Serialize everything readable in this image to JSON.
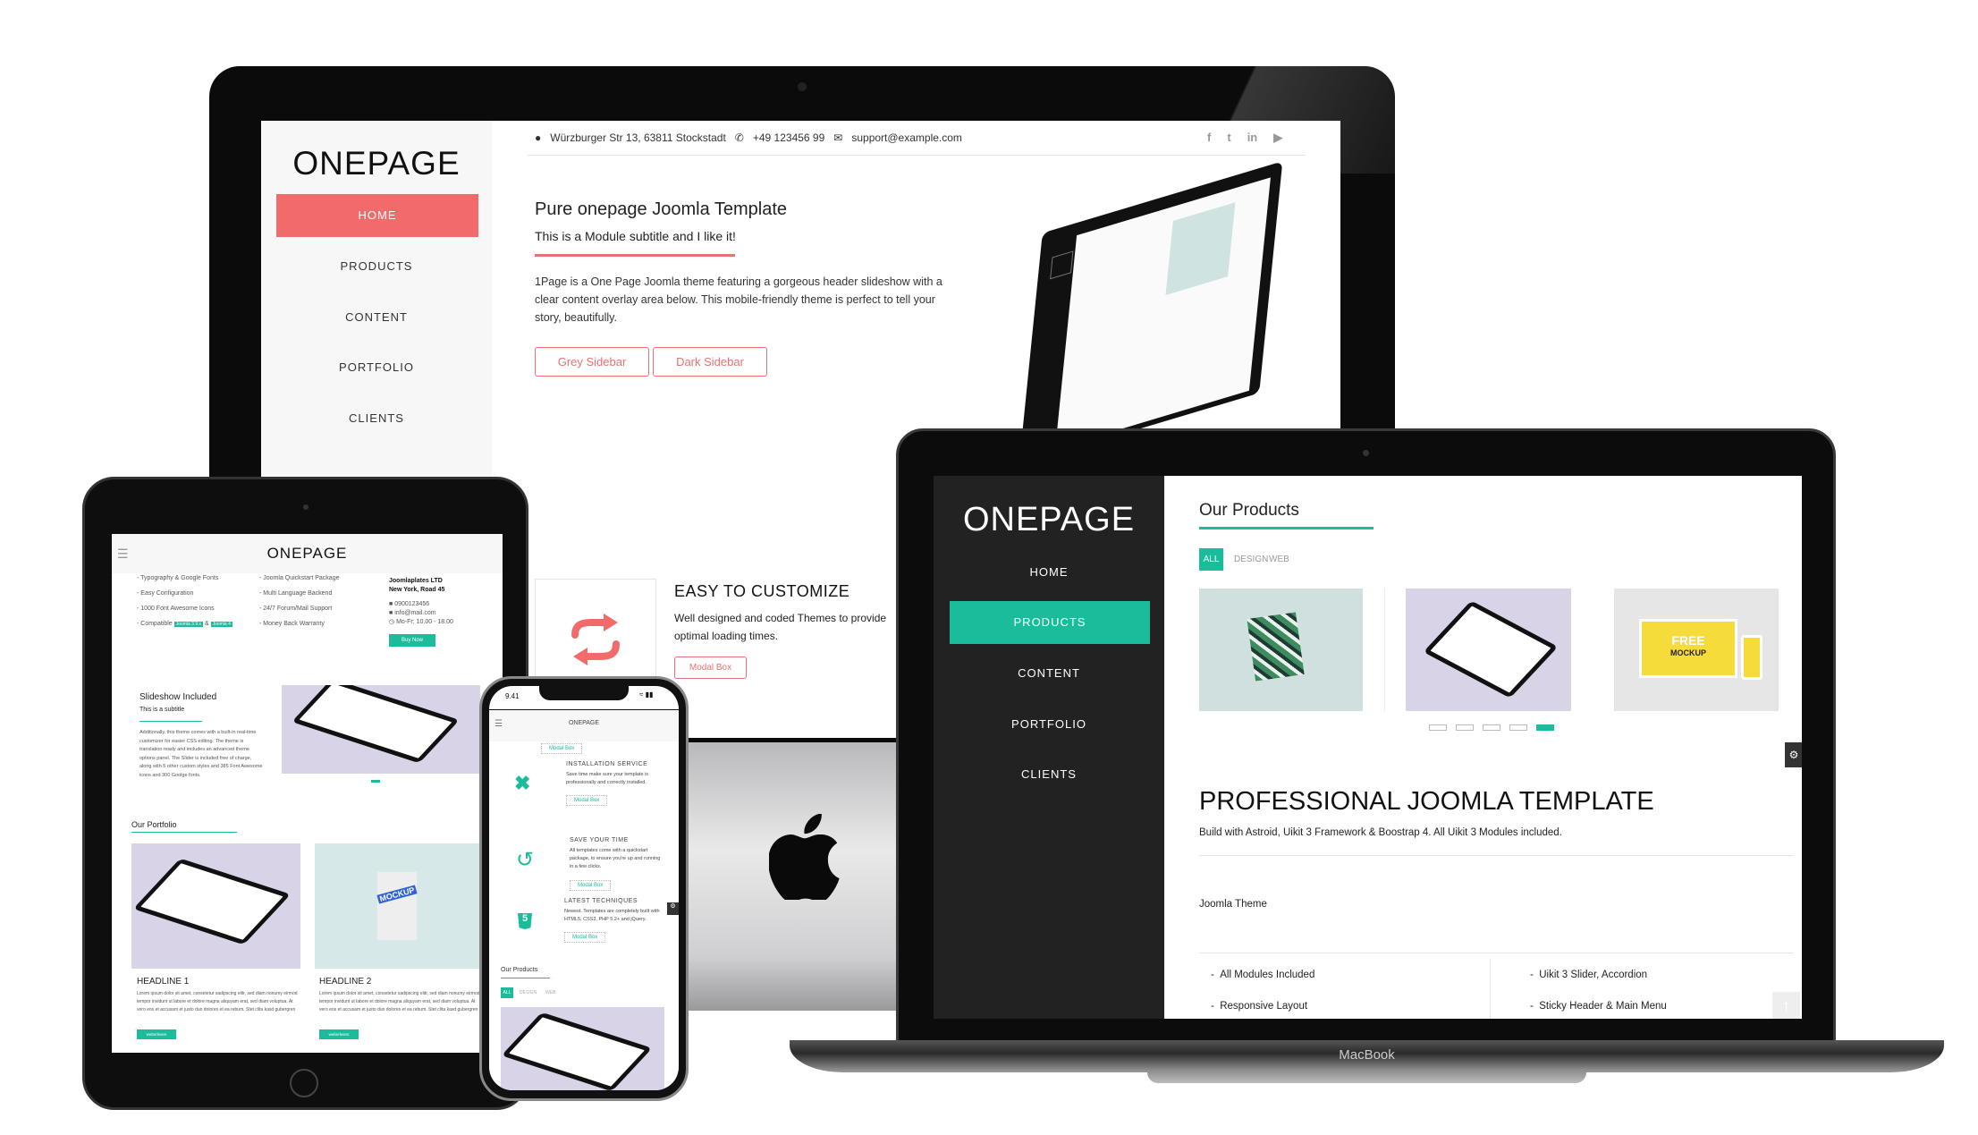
{
  "colors": {
    "accent_red": "#f26b6b",
    "accent_teal": "#1abc9c",
    "dark_sidebar": "#222222"
  },
  "imac": {
    "logo": "ONEPAGE",
    "nav": [
      {
        "label": "HOME",
        "active": true
      },
      {
        "label": "PRODUCTS"
      },
      {
        "label": "CONTENT"
      },
      {
        "label": "PORTFOLIO"
      },
      {
        "label": "CLIENTS"
      }
    ],
    "topbar": {
      "address": "Würzburger Str 13, 63811 Stockstadt",
      "phone": "+49 123456 99",
      "email": "support@example.com",
      "social": [
        "facebook-icon",
        "twitter-icon",
        "linkedin-icon",
        "youtube-icon"
      ]
    },
    "hero": {
      "title": "Pure onepage Joomla Template",
      "subtitle": "This is a Module subtitle and I like it!",
      "text": "1Page is a One Page Joomla theme featuring a gorgeous header slideshow with a clear content overlay area below. This mobile-friendly theme is perfect to tell your story, beautifully.",
      "buttons": [
        "Grey Sidebar",
        "Dark Sidebar"
      ]
    },
    "feature": {
      "icon": "refresh-icon",
      "title": "EASY TO CUSTOMIZE",
      "text": "Well designed and coded Themes to provide optimal loading times.",
      "button": "Modal Box"
    }
  },
  "laptop": {
    "brand": "MacBook",
    "logo": "ONEPAGE",
    "nav": [
      {
        "label": "HOME"
      },
      {
        "label": "PRODUCTS",
        "active": true
      },
      {
        "label": "CONTENT"
      },
      {
        "label": "PORTFOLIO"
      },
      {
        "label": "CLIENTS"
      }
    ],
    "products": {
      "title": "Our Products",
      "filters": [
        "ALL",
        "DESIGN",
        "WEB"
      ],
      "active_filter": "ALL",
      "slider_dots": 5,
      "active_dot": 5
    },
    "mockup_text": {
      "free": "FREE",
      "mockup": "MOCKUP"
    },
    "section": {
      "title": "PROFESSIONAL JOOMLA TEMPLATE",
      "subtitle": "Build with Astroid, Uikit 3 Framework & Boostrap 4. All Uikit 3 Modules included.",
      "tag": "Joomla Theme",
      "list_left": [
        "All Modules Included",
        "Responsive Layout"
      ],
      "list_right": [
        "Uikit 3 Slider, Accordion",
        "Sticky Header & Main Menu"
      ]
    }
  },
  "tablet": {
    "logo": "ONEPAGE",
    "col1": [
      "Typography & Google Fonts",
      "Easy Configuration",
      "1000 Font Awesome Icons",
      "Compatible"
    ],
    "badges": [
      "Joomla 3.9.x",
      "Joomla 4"
    ],
    "amp": "&",
    "col2": [
      "Joomla Quickstart Package",
      "Multi Language Backend",
      "24/7 Forum/Mail Support",
      "Money Back Warranty"
    ],
    "contact": {
      "company": "Joomlaplates LTD",
      "address": "New York, Road 45",
      "phone": "0900123456",
      "email": "info@mail.com",
      "hours": "Mo-Fr: 10.00 - 18.00",
      "button": "Buy Now"
    },
    "slideshow": {
      "title": "Slideshow Included",
      "subtitle": "This is a subtitle",
      "text": "Additionally, this theme comes with a built-in real-time customizer for easier CSS editing. The theme is translation ready and includes an advanced theme options panel. The Slider is included free of charge, along with 5 other custom styles and 385 Font Awesome icons and 300 Goolge fonts."
    },
    "portfolio": {
      "title": "Our Portfolio",
      "items": [
        {
          "headline": "HEADLINE 1",
          "text": "Lorem ipsum dolor sit amet, consetetur sadipscing elitr, sed diam nonumy eirmod tempor invidunt ut labore et dolore magna aliquyam erat, sed diam voluptua. At vero eos et accusam et justo duo dolores et ea rebum. Stet clita kasd gubergren",
          "button": "weiterlesen"
        },
        {
          "headline": "HEADLINE 2",
          "text": "Lorem ipsum dolor sit amet, consetetur sadipscing elitr, sed diam nonumy eirmod tempor invidunt ut labore et dolore magna aliquyam erat, sed diam voluptua. At vero eos et accusam et justo duo dolores et ea rebum. Stet clita kasd gubergren",
          "button": "weiterlesen"
        }
      ]
    },
    "mockup_letters": "MOCKUP"
  },
  "phone": {
    "time": "9.41",
    "logo": "ONEPAGE",
    "modal": "Modal Box",
    "features": [
      {
        "icon": "joomla-icon",
        "title": "INSTALLATION SERVICE",
        "text": "Save time make sure your template is professionally and correctly installed."
      },
      {
        "icon": "history-icon",
        "title": "SAVE YOUR TIME",
        "text": "All templates come with a quickstart package, to ensure you're up and running in a few clicks."
      },
      {
        "icon": "html5-icon",
        "title": "LATEST TECHNIQUES",
        "text": "Newest. Templates are completely built with HTML5, CSS3, PHP 5.2+ and jQuery."
      }
    ],
    "products": {
      "title": "Our Products",
      "filters": [
        "ALL",
        "DESIGN",
        "WEB"
      ]
    }
  }
}
